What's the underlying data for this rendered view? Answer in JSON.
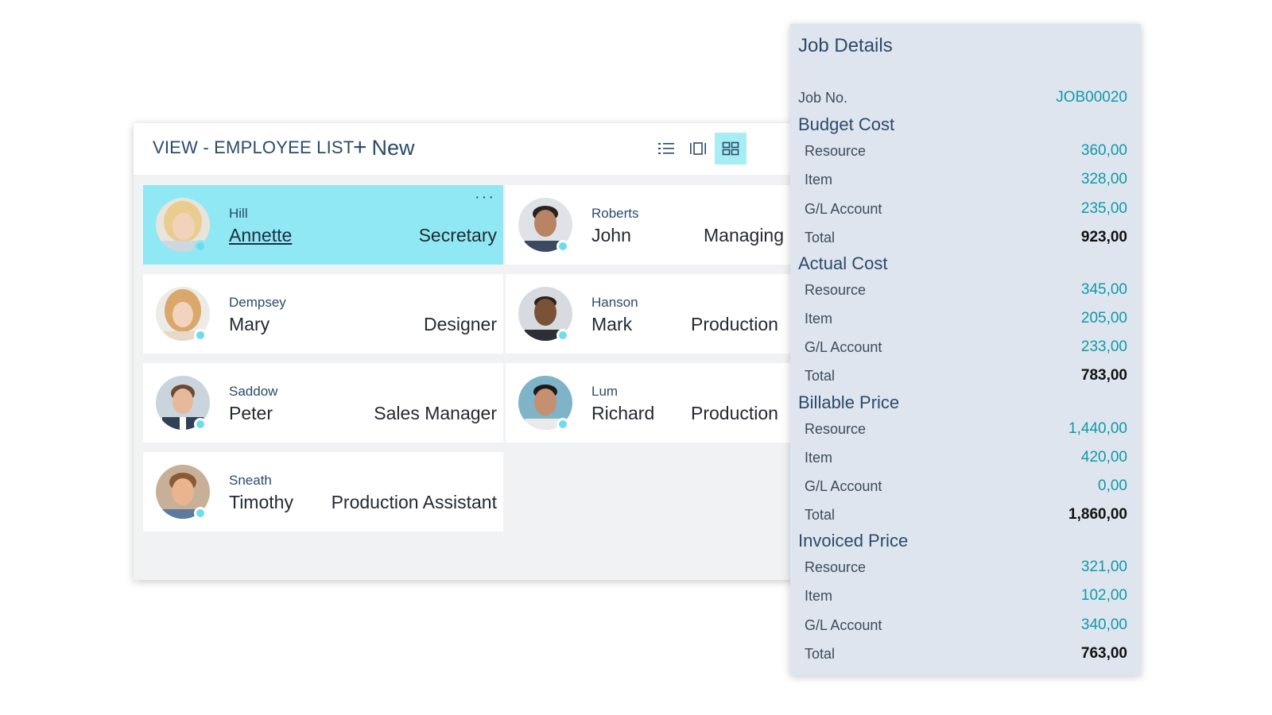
{
  "header": {
    "view_title": "VIEW - EMPLOYEE LIST",
    "new_label": "New",
    "toggles": [
      "list-icon",
      "tall-tiles-icon",
      "tiles-icon"
    ]
  },
  "employees": [
    {
      "last": "Hill",
      "first": "Annette",
      "title": "Secretary",
      "more": "···",
      "selected": true
    },
    {
      "last": "Roberts",
      "first": "John",
      "title": "Managing"
    },
    {
      "last": "Dempsey",
      "first": "Mary",
      "title": "Designer"
    },
    {
      "last": "Hanson",
      "first": "Mark",
      "title": "Production"
    },
    {
      "last": "Saddow",
      "first": "Peter",
      "title": "Sales Manager"
    },
    {
      "last": "Lum",
      "first": "Richard",
      "title": "Production"
    },
    {
      "last": "Sneath",
      "first": "Timothy",
      "title": "Production Assistant"
    }
  ],
  "job_details": {
    "title": "Job Details",
    "job_no_label": "Job No.",
    "job_no": "JOB00020",
    "sections": [
      {
        "name": "Budget Cost",
        "rows": [
          {
            "label": "Resource",
            "value": "360,00"
          },
          {
            "label": "Item",
            "value": "328,00"
          },
          {
            "label": "G/L Account",
            "value": "235,00"
          },
          {
            "label": "Total",
            "value": "923,00"
          }
        ]
      },
      {
        "name": "Actual Cost",
        "rows": [
          {
            "label": "Resource",
            "value": "345,00"
          },
          {
            "label": "Item",
            "value": "205,00"
          },
          {
            "label": "G/L Account",
            "value": "233,00"
          },
          {
            "label": "Total",
            "value": "783,00"
          }
        ]
      },
      {
        "name": "Billable Price",
        "rows": [
          {
            "label": "Resource",
            "value": "1,440,00"
          },
          {
            "label": "Item",
            "value": "420,00"
          },
          {
            "label": "G/L Account",
            "value": "0,00"
          },
          {
            "label": "Total",
            "value": "1,860,00"
          }
        ]
      },
      {
        "name": "Invoiced Price",
        "rows": [
          {
            "label": "Resource",
            "value": "321,00"
          },
          {
            "label": "Item",
            "value": "102,00"
          },
          {
            "label": "G/L Account",
            "value": "340,00"
          },
          {
            "label": "Total",
            "value": "763,00"
          }
        ]
      }
    ]
  },
  "colors": {
    "accent": "#8fe8f3",
    "toggle_active": "#a6eef4",
    "value_teal": "#0f9aa6",
    "heading_blue": "#2b4a6b",
    "factbox_bg": "#dee5ee"
  }
}
